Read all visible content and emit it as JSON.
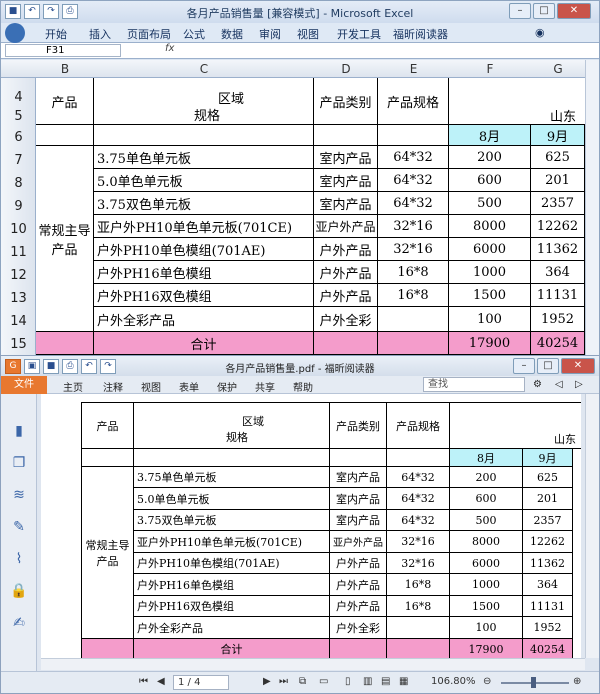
{
  "excel": {
    "title": "各月产品销售量  [兼容模式] - Microsoft Excel",
    "tabs": [
      "开始",
      "插入",
      "页面布局",
      "公式",
      "数据",
      "审阅",
      "视图",
      "开发工具",
      "福昕阅读器"
    ],
    "namebox": "F31",
    "fx": "fx",
    "columns": [
      "B",
      "C",
      "D",
      "E",
      "F",
      "G"
    ],
    "rows": [
      "4",
      "5",
      "6",
      "7",
      "8",
      "9",
      "10",
      "11",
      "12",
      "13",
      "14",
      "15"
    ]
  },
  "table": {
    "product_header": "产品",
    "region_label": "区域",
    "spec_label": "规格",
    "category_header": "产品类别",
    "spec_header": "产品规格",
    "province": "山东",
    "months": [
      "8月",
      "9月"
    ],
    "group_label": "常规主导产品",
    "rows": [
      {
        "name": "3.75单色单元板",
        "category": "室内产品",
        "spec": "64*32",
        "m8": "200",
        "m9": "625"
      },
      {
        "name": "5.0单色单元板",
        "category": "室内产品",
        "spec": "64*32",
        "m8": "600",
        "m9": "201"
      },
      {
        "name": "3.75双色单元板",
        "category": "室内产品",
        "spec": "64*32",
        "m8": "500",
        "m9": "2357"
      },
      {
        "name": "亚户外PH10单色单元板(701CE)",
        "category": "亚户外产品",
        "spec": "32*16",
        "m8": "8000",
        "m9": "12262"
      },
      {
        "name": "户外PH10单色模组(701AE)",
        "category": "户外产品",
        "spec": "32*16",
        "m8": "6000",
        "m9": "11362"
      },
      {
        "name": "户外PH16单色模组",
        "category": "户外产品",
        "spec": "16*8",
        "m8": "1000",
        "m9": "364"
      },
      {
        "name": "户外PH16双色模组",
        "category": "户外产品",
        "spec": "16*8",
        "m8": "1500",
        "m9": "11131"
      },
      {
        "name": "户外全彩产品",
        "category": "户外全彩",
        "spec": "",
        "m8": "100",
        "m9": "1952"
      }
    ],
    "total_label": "合计",
    "total_m8": "17900",
    "total_m9": "40254"
  },
  "reader": {
    "title": "各月产品销售量.pdf - 福昕阅读器",
    "menu": [
      "文件",
      "主页",
      "注释",
      "视图",
      "表单",
      "保护",
      "共享",
      "帮助"
    ],
    "search_placeholder": "查找",
    "page_indicator": "1 / 4",
    "zoom": "106.80%"
  },
  "colors": {
    "total_row": "#f49ccb",
    "month_header": "#bdf2f9",
    "file_menu": "#e8782f"
  }
}
